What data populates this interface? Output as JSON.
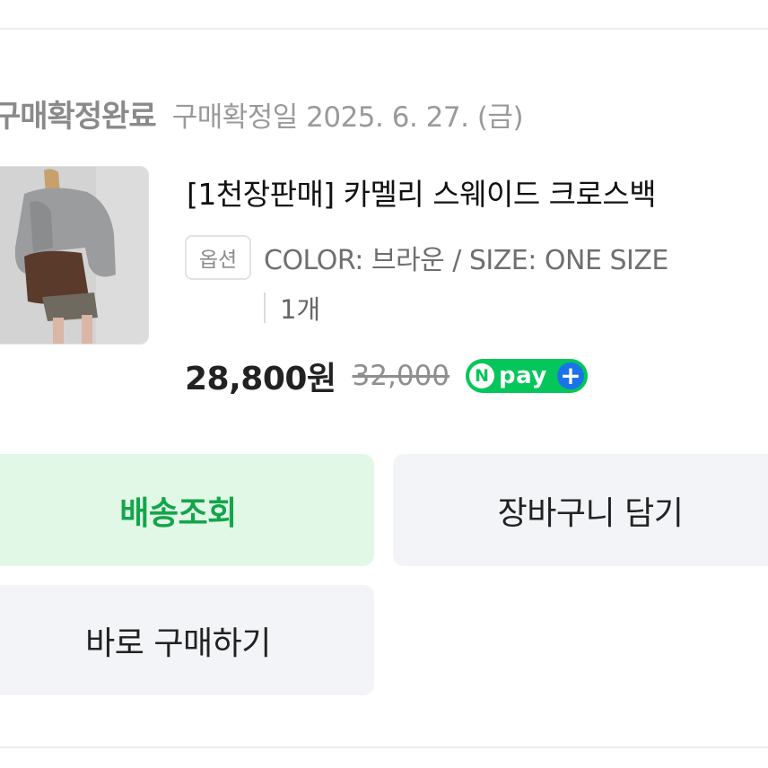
{
  "order": {
    "status_title": "구매확정완료",
    "confirm_date": "구매확정일 2025. 6. 27. (금)"
  },
  "product": {
    "name": "[1천장판매] 카멜리 스웨이드 크로스백",
    "option_label": "옵션",
    "option_value": "COLOR: 브라운 / SIZE: ONE SIZE",
    "quantity": "1개",
    "price": "28,800원",
    "original_price": "32,000",
    "npay": {
      "n": "N",
      "text": "pay",
      "plus": "+",
      "color": "#03c75a",
      "plus_color": "#1a73e8"
    },
    "thumbnail_icon": "product-photo"
  },
  "actions": {
    "track_label": "배송조회",
    "cart_label": "장바구니 담기",
    "buy_label": "바로 구매하기"
  },
  "colors": {
    "accent_green": "#13a54b",
    "track_bg": "#e2f8e6",
    "button_bg": "#f2f4f7"
  }
}
